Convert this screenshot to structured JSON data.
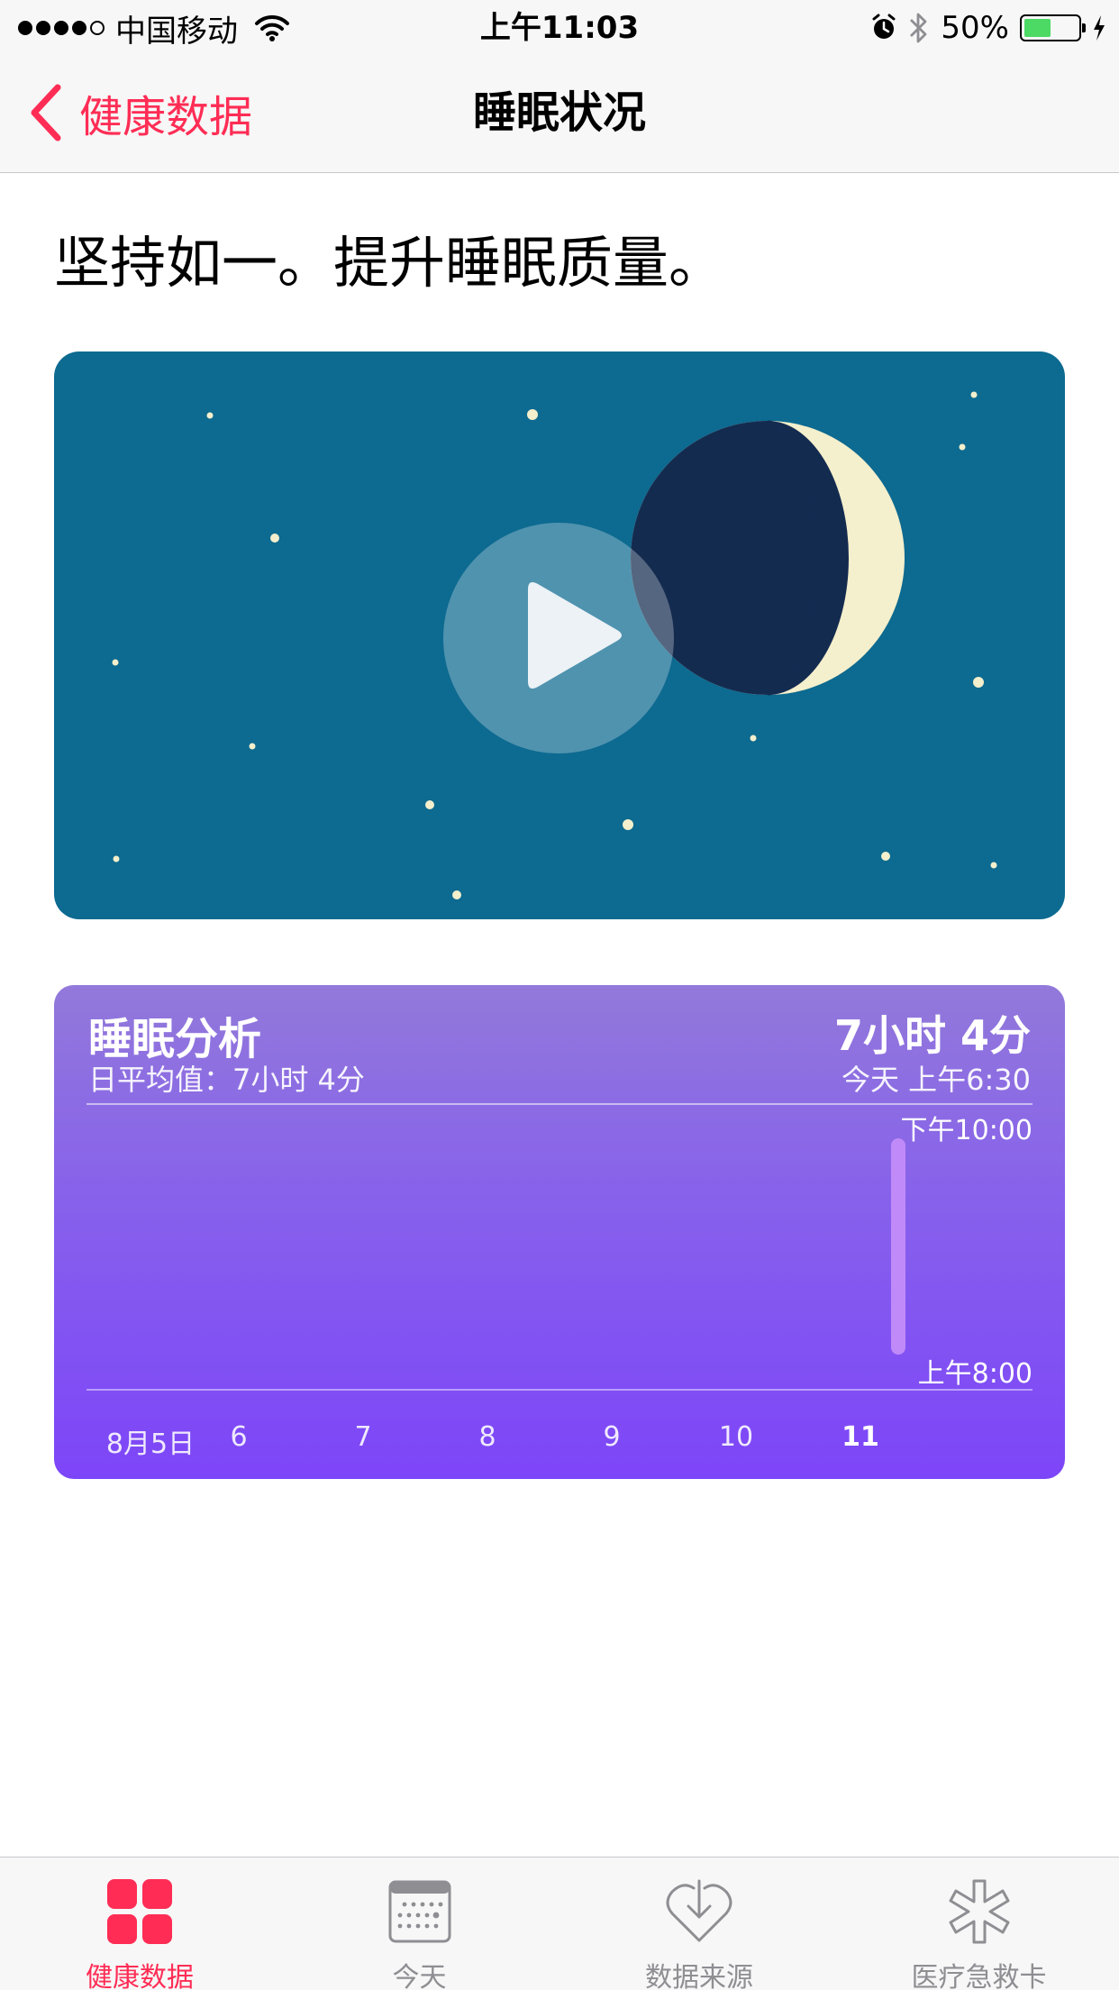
{
  "status_bar": {
    "carrier": "中国移动",
    "time": "上午11:03",
    "battery_percent": "50%",
    "battery_level": 0.5,
    "signal_bars_filled": 4,
    "signal_bars_total": 5,
    "icons": [
      "wifi-icon",
      "alarm-icon",
      "bluetooth-icon",
      "battery-icon",
      "charging-icon"
    ]
  },
  "nav": {
    "back_label": "健康数据",
    "title": "睡眠状况"
  },
  "headline": "坚持如一。提升睡眠质量。",
  "video": {
    "icons": [
      "play-icon",
      "moon-icon",
      "star-icon"
    ],
    "colors": {
      "background": "#0d6a90",
      "moon_dark": "#142b50",
      "moon_light": "#f4efcc"
    }
  },
  "sleep_analysis": {
    "title": "睡眠分析",
    "average_label": "日平均值：7小时 4分",
    "total": "7小时 4分",
    "date": "今天 上午6:30",
    "y_top_label": "下午10:00",
    "y_bottom_label": "上午8:00",
    "x_labels": [
      "8月5日",
      "6",
      "7",
      "8",
      "9",
      "10",
      "11"
    ],
    "selected_index": 6
  },
  "tab_bar": {
    "tabs": [
      {
        "label": "健康数据",
        "icon": "health-data-icon",
        "active": true
      },
      {
        "label": "今天",
        "icon": "calendar-icon",
        "active": false
      },
      {
        "label": "数据来源",
        "icon": "sources-icon",
        "active": false
      },
      {
        "label": "医疗急救卡",
        "icon": "medical-id-icon",
        "active": false
      }
    ],
    "colors": {
      "active": "#ff2d55",
      "inactive": "#8e8e93"
    }
  }
}
